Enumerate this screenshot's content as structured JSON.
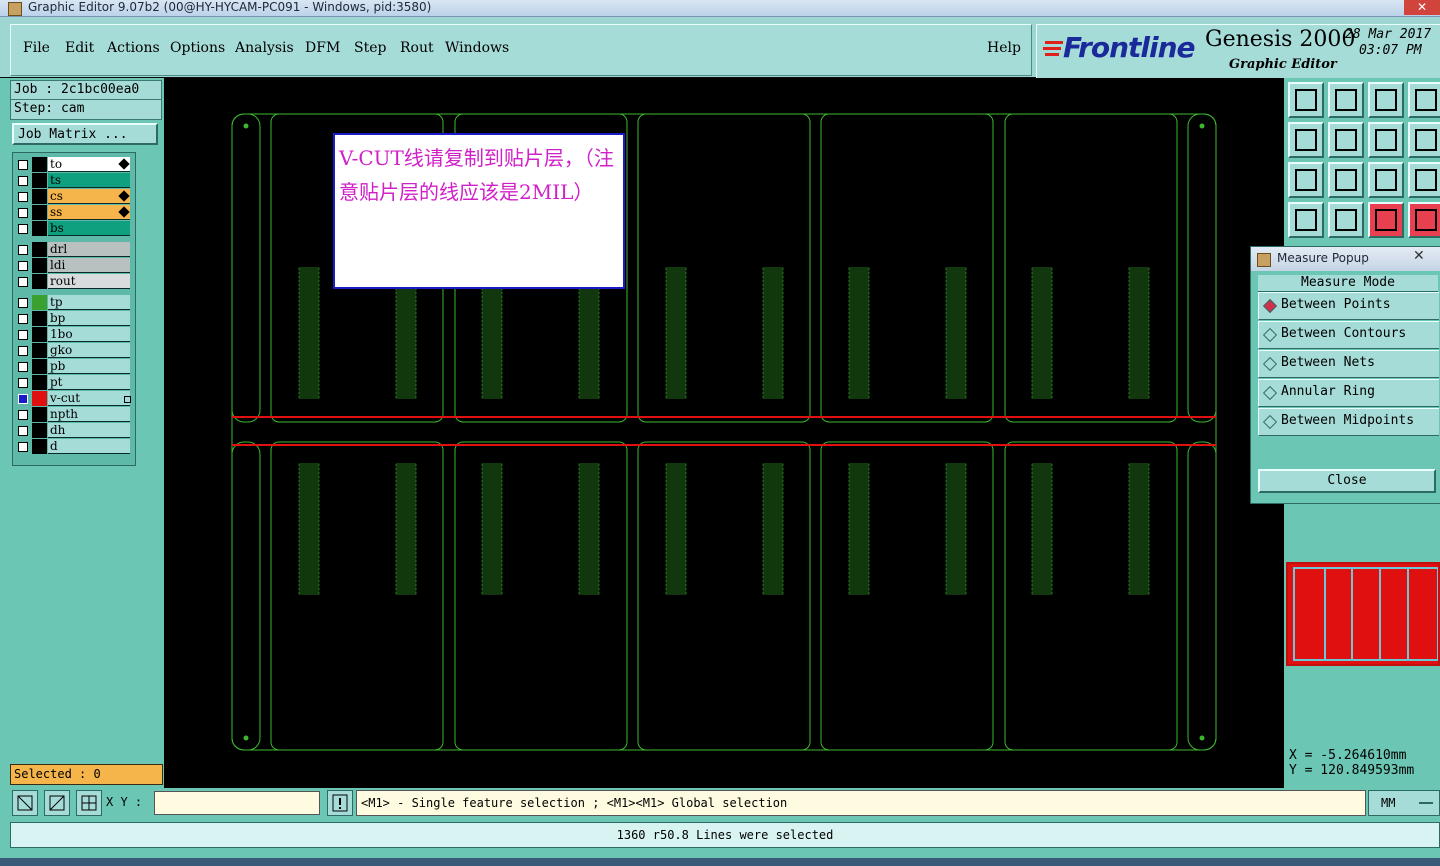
{
  "window": {
    "title": "Graphic Editor 9.07b2 (00@HY-HYCAM-PC091 - Windows, pid:3580)",
    "close_label": "✕"
  },
  "menu": {
    "items": [
      "File",
      "Edit",
      "Actions",
      "Options",
      "Analysis",
      "DFM",
      "Step",
      "Rout",
      "Windows"
    ],
    "help": "Help"
  },
  "brand": {
    "logo": "Frontline",
    "product": "Genesis 2000",
    "subtitle": "Graphic Editor",
    "date": "28 Mar 2017",
    "time": "03:07 PM"
  },
  "job": {
    "job_line": "Job : 2c1bc00ea0",
    "step_line": "Step: cam",
    "matrix_button": "Job Matrix ..."
  },
  "layers": [
    {
      "name": "to",
      "color": "#ffffff",
      "swatch": "#000000",
      "pen": true
    },
    {
      "name": "ts",
      "color": "#0fa080",
      "swatch": "#000000",
      "pen": false
    },
    {
      "name": "cs",
      "color": "#f5b54a",
      "swatch": "#000000",
      "pen": true
    },
    {
      "name": "ss",
      "color": "#f5b54a",
      "swatch": "#000000",
      "pen": true
    },
    {
      "name": "bs",
      "color": "#0fa080",
      "swatch": "#000000",
      "pen": false
    },
    {
      "name": "drl",
      "color": "#b8c0c0",
      "swatch": "#000000",
      "pen": false
    },
    {
      "name": "ldi",
      "color": "#b8c0c0",
      "swatch": "#000000",
      "pen": false
    },
    {
      "name": "rout",
      "color": "#d8dcdc",
      "swatch": "#000000",
      "pen": false
    },
    {
      "name": "tp",
      "color": "#a6dcd8",
      "swatch": "#3aa030",
      "pen": false
    },
    {
      "name": "bp",
      "color": "#a6dcd8",
      "swatch": "#000000",
      "pen": false
    },
    {
      "name": "1bo",
      "color": "#a6dcd8",
      "swatch": "#000000",
      "pen": false
    },
    {
      "name": "gko",
      "color": "#a6dcd8",
      "swatch": "#000000",
      "pen": false
    },
    {
      "name": "pb",
      "color": "#a6dcd8",
      "swatch": "#000000",
      "pen": false
    },
    {
      "name": "pt",
      "color": "#a6dcd8",
      "swatch": "#000000",
      "pen": false
    },
    {
      "name": "v-cut",
      "color": "#a6dcd8",
      "swatch": "#e01010",
      "pen": false,
      "active": true
    },
    {
      "name": "npth",
      "color": "#a6dcd8",
      "swatch": "#000000",
      "pen": false
    },
    {
      "name": "dh",
      "color": "#a6dcd8",
      "swatch": "#000000",
      "pen": false
    },
    {
      "name": "d",
      "color": "#a6dcd8",
      "swatch": "#000000",
      "pen": false
    }
  ],
  "selected": "Selected : 0",
  "note": "V-CUT线请复制到贴片层，（注意贴片层的线应该是2MIL）",
  "measure": {
    "title": "Measure Popup",
    "mode_label": "Measure Mode",
    "options": [
      "Between Points",
      "Between Contours",
      "Between Nets",
      "Annular Ring",
      "Between Midpoints"
    ],
    "selected_option": "Between Points",
    "close": "Close"
  },
  "coords": {
    "x": "X = -5.264610mm",
    "y": "Y = 120.849593mm"
  },
  "bottom": {
    "xy_label": "X Y :",
    "xy_value": "",
    "hint": "<M1> - Single feature selection ; <M1><M1> Global selection",
    "units": "MM",
    "status": "1360 r50.8 Lines were selected"
  },
  "colors": {
    "outline": "#3cb830",
    "vcut": "#e01010",
    "panel": "#6cc6b4",
    "button": "#a6dcd8"
  }
}
